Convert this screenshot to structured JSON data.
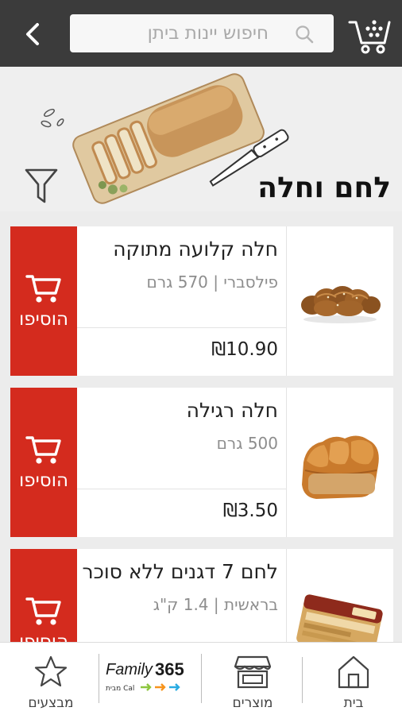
{
  "header": {
    "search_placeholder": "חיפוש יינות ביתן",
    "icons": {
      "back": "chevron-left-icon",
      "search": "search-icon",
      "cart": "shopping-basket-icon"
    }
  },
  "category": {
    "title": "לחם וחלה",
    "filter_icon": "filter-icon"
  },
  "products": [
    {
      "name": "חלה קלועה מתוקה",
      "meta": "פילסברי | 570 גרם",
      "price": "₪10.90",
      "add_label": "הוסיפו"
    },
    {
      "name": "חלה רגילה",
      "meta": "500 גרם",
      "price": "₪3.50",
      "add_label": "הוסיפו"
    },
    {
      "name": "לחם 7 דגנים ללא סוכר",
      "meta": "בראשית | 1.4 ק\"ג",
      "price": "",
      "add_label": "הוסיפו"
    }
  ],
  "bottom_nav": {
    "deals": "מבצעים",
    "family_logo": {
      "word": "Family",
      "number": "365",
      "sub": "מבית Cal"
    },
    "products": "מוצרים",
    "home": "בית"
  },
  "colors": {
    "accent": "#d42b1e",
    "topbar": "#3b3b3b",
    "background": "#ececec"
  }
}
